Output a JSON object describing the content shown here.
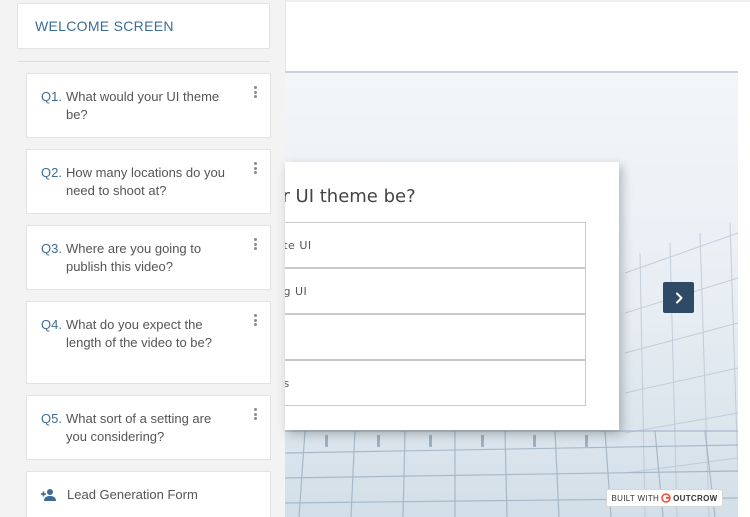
{
  "sidebar": {
    "welcome_label": "WELCOME SCREEN",
    "questions": [
      {
        "num": "Q1.",
        "label": "What would your UI theme be?"
      },
      {
        "num": "Q2.",
        "label": "How many locations do you need to shoot at?"
      },
      {
        "num": "Q3.",
        "label": "Where are you going to publish this video?"
      },
      {
        "num": "Q4.",
        "label": "What do you expect the length of the video to be?"
      },
      {
        "num": "Q5.",
        "label": "What sort of a setting are you considering?"
      }
    ],
    "lead_form_label": "Lead Generation Form",
    "lead_form_icon": "user-plus-icon",
    "menu_icon": "kebab-menu-icon"
  },
  "preview": {
    "question_title": "ur UI theme be?",
    "options": [
      "ate UI",
      "ng UI",
      "",
      "ns"
    ],
    "next_icon": "chevron-right-icon",
    "badge": {
      "prefix": "BUILT WITH",
      "brand": "OUTCROW"
    },
    "colors": {
      "accent": "#3d6d96",
      "next_button": "#2f4a67",
      "brand_red": "#e8533f"
    }
  }
}
